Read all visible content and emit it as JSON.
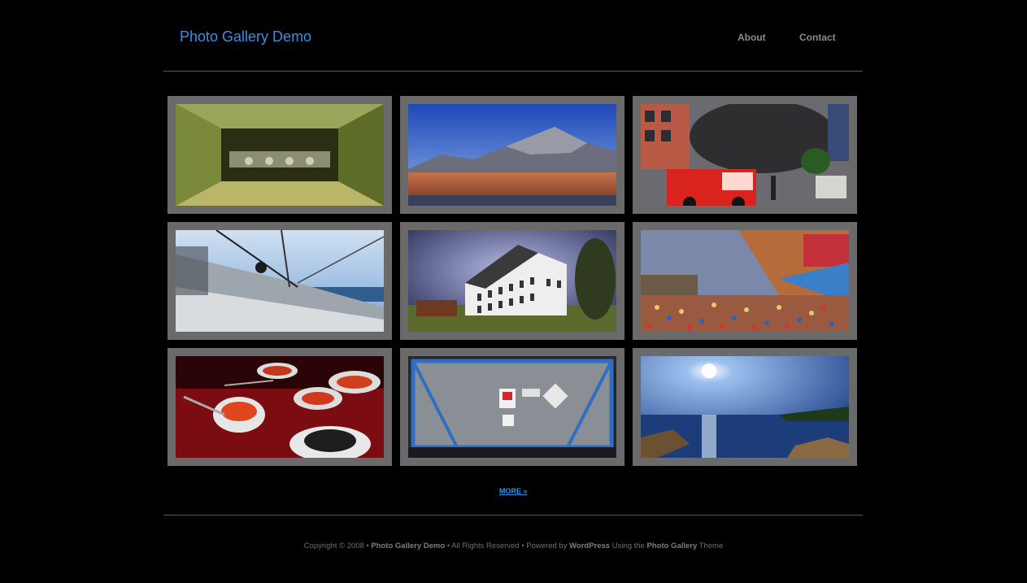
{
  "header": {
    "site_title": "Photo Gallery Demo"
  },
  "nav": {
    "about": "About",
    "contact": "Contact"
  },
  "gallery": {
    "photos": [
      {
        "subject": "tunnel-hall"
      },
      {
        "subject": "desert-mountains"
      },
      {
        "subject": "fire-truck"
      },
      {
        "subject": "sailboat-deck"
      },
      {
        "subject": "white-building"
      },
      {
        "subject": "market-crowd"
      },
      {
        "subject": "caviar-bowls"
      },
      {
        "subject": "tank-container"
      },
      {
        "subject": "lake-shore"
      }
    ],
    "more_label": "MORE »"
  },
  "footer": {
    "copyright": "Copyright © 2008 •",
    "site_name": "Photo Gallery Demo",
    "rights": "• All Rights Reserved • Powered by",
    "wordpress": "WordPress",
    "using_the": "Using the",
    "theme_name": "Photo Gallery",
    "theme_word": "Theme"
  }
}
